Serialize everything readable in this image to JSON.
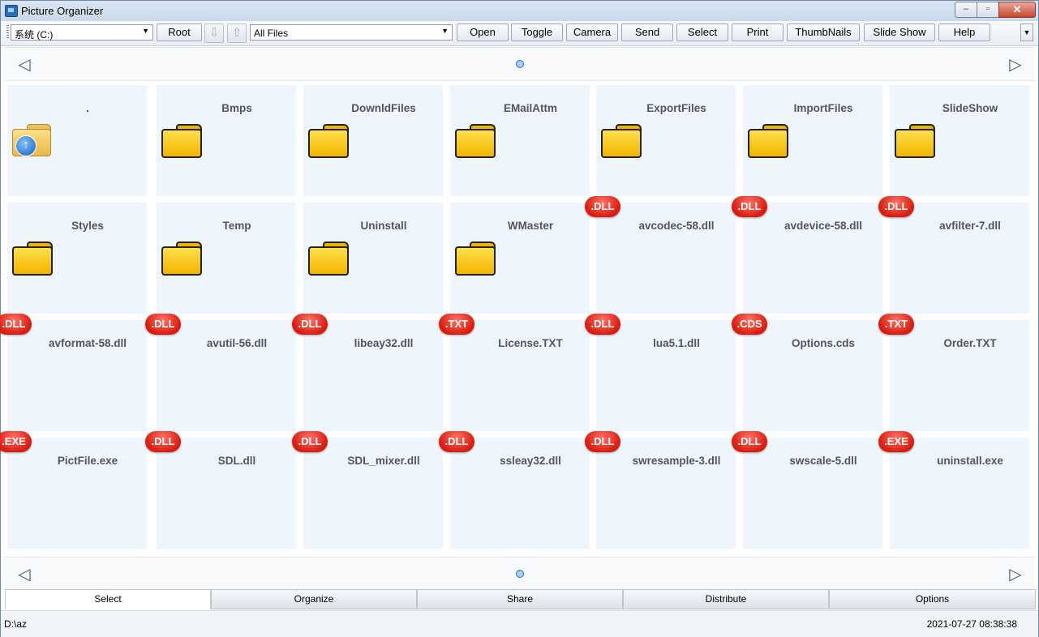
{
  "window": {
    "title": "Picture Organizer",
    "minimize": "–",
    "maximize": "▫",
    "close": "✕"
  },
  "toolbar": {
    "drive": "系统 (C:)",
    "root_label": "Root",
    "filter": "All Files",
    "buttons": [
      "Open",
      "Toggle",
      "Camera",
      "Send",
      "Select",
      "Print",
      "ThumbNails",
      "Slide Show",
      "Help"
    ]
  },
  "pager": {
    "prev": "◁",
    "next": "▷"
  },
  "tiles": [
    {
      "name": ".",
      "kind": "folder-up"
    },
    {
      "name": "Bmps",
      "kind": "folder"
    },
    {
      "name": "DownldFiles",
      "kind": "folder"
    },
    {
      "name": "EMailAttm",
      "kind": "folder"
    },
    {
      "name": "ExportFiles",
      "kind": "folder"
    },
    {
      "name": "ImportFiles",
      "kind": "folder"
    },
    {
      "name": "SlideShow",
      "kind": "folder"
    },
    {
      "name": "Styles",
      "kind": "folder"
    },
    {
      "name": "Temp",
      "kind": "folder"
    },
    {
      "name": "Uninstall",
      "kind": "folder"
    },
    {
      "name": "WMaster",
      "kind": "folder"
    },
    {
      "name": "avcodec-58.dll",
      "kind": "file",
      "badge": ".DLL"
    },
    {
      "name": "avdevice-58.dll",
      "kind": "file",
      "badge": ".DLL"
    },
    {
      "name": "avfilter-7.dll",
      "kind": "file",
      "badge": ".DLL"
    },
    {
      "name": "avformat-58.dll",
      "kind": "file",
      "badge": ".DLL"
    },
    {
      "name": "avutil-56.dll",
      "kind": "file",
      "badge": ".DLL"
    },
    {
      "name": "libeay32.dll",
      "kind": "file",
      "badge": ".DLL"
    },
    {
      "name": "License.TXT",
      "kind": "file",
      "badge": ".TXT"
    },
    {
      "name": "lua5.1.dll",
      "kind": "file",
      "badge": ".DLL"
    },
    {
      "name": "Options.cds",
      "kind": "file",
      "badge": ".CDS"
    },
    {
      "name": "Order.TXT",
      "kind": "file",
      "badge": ".TXT"
    },
    {
      "name": "PictFile.exe",
      "kind": "file",
      "badge": ".EXE"
    },
    {
      "name": "SDL.dll",
      "kind": "file",
      "badge": ".DLL"
    },
    {
      "name": "SDL_mixer.dll",
      "kind": "file",
      "badge": ".DLL"
    },
    {
      "name": "ssleay32.dll",
      "kind": "file",
      "badge": ".DLL"
    },
    {
      "name": "swresample-3.dll",
      "kind": "file",
      "badge": ".DLL"
    },
    {
      "name": "swscale-5.dll",
      "kind": "file",
      "badge": ".DLL"
    },
    {
      "name": "uninstall.exe",
      "kind": "file",
      "badge": ".EXE"
    }
  ],
  "tabs": [
    {
      "label": "Select",
      "active": true
    },
    {
      "label": "Organize",
      "active": false
    },
    {
      "label": "Share",
      "active": false
    },
    {
      "label": "Distribute",
      "active": false
    },
    {
      "label": "Options",
      "active": false
    }
  ],
  "status": {
    "path": "D:\\az",
    "datetime": "2021-07-27 08:38:38"
  },
  "colors": {
    "badge_red": "#d81d10",
    "tile_bg": "#eef5fc",
    "folder_yellow": "#f3b400"
  }
}
